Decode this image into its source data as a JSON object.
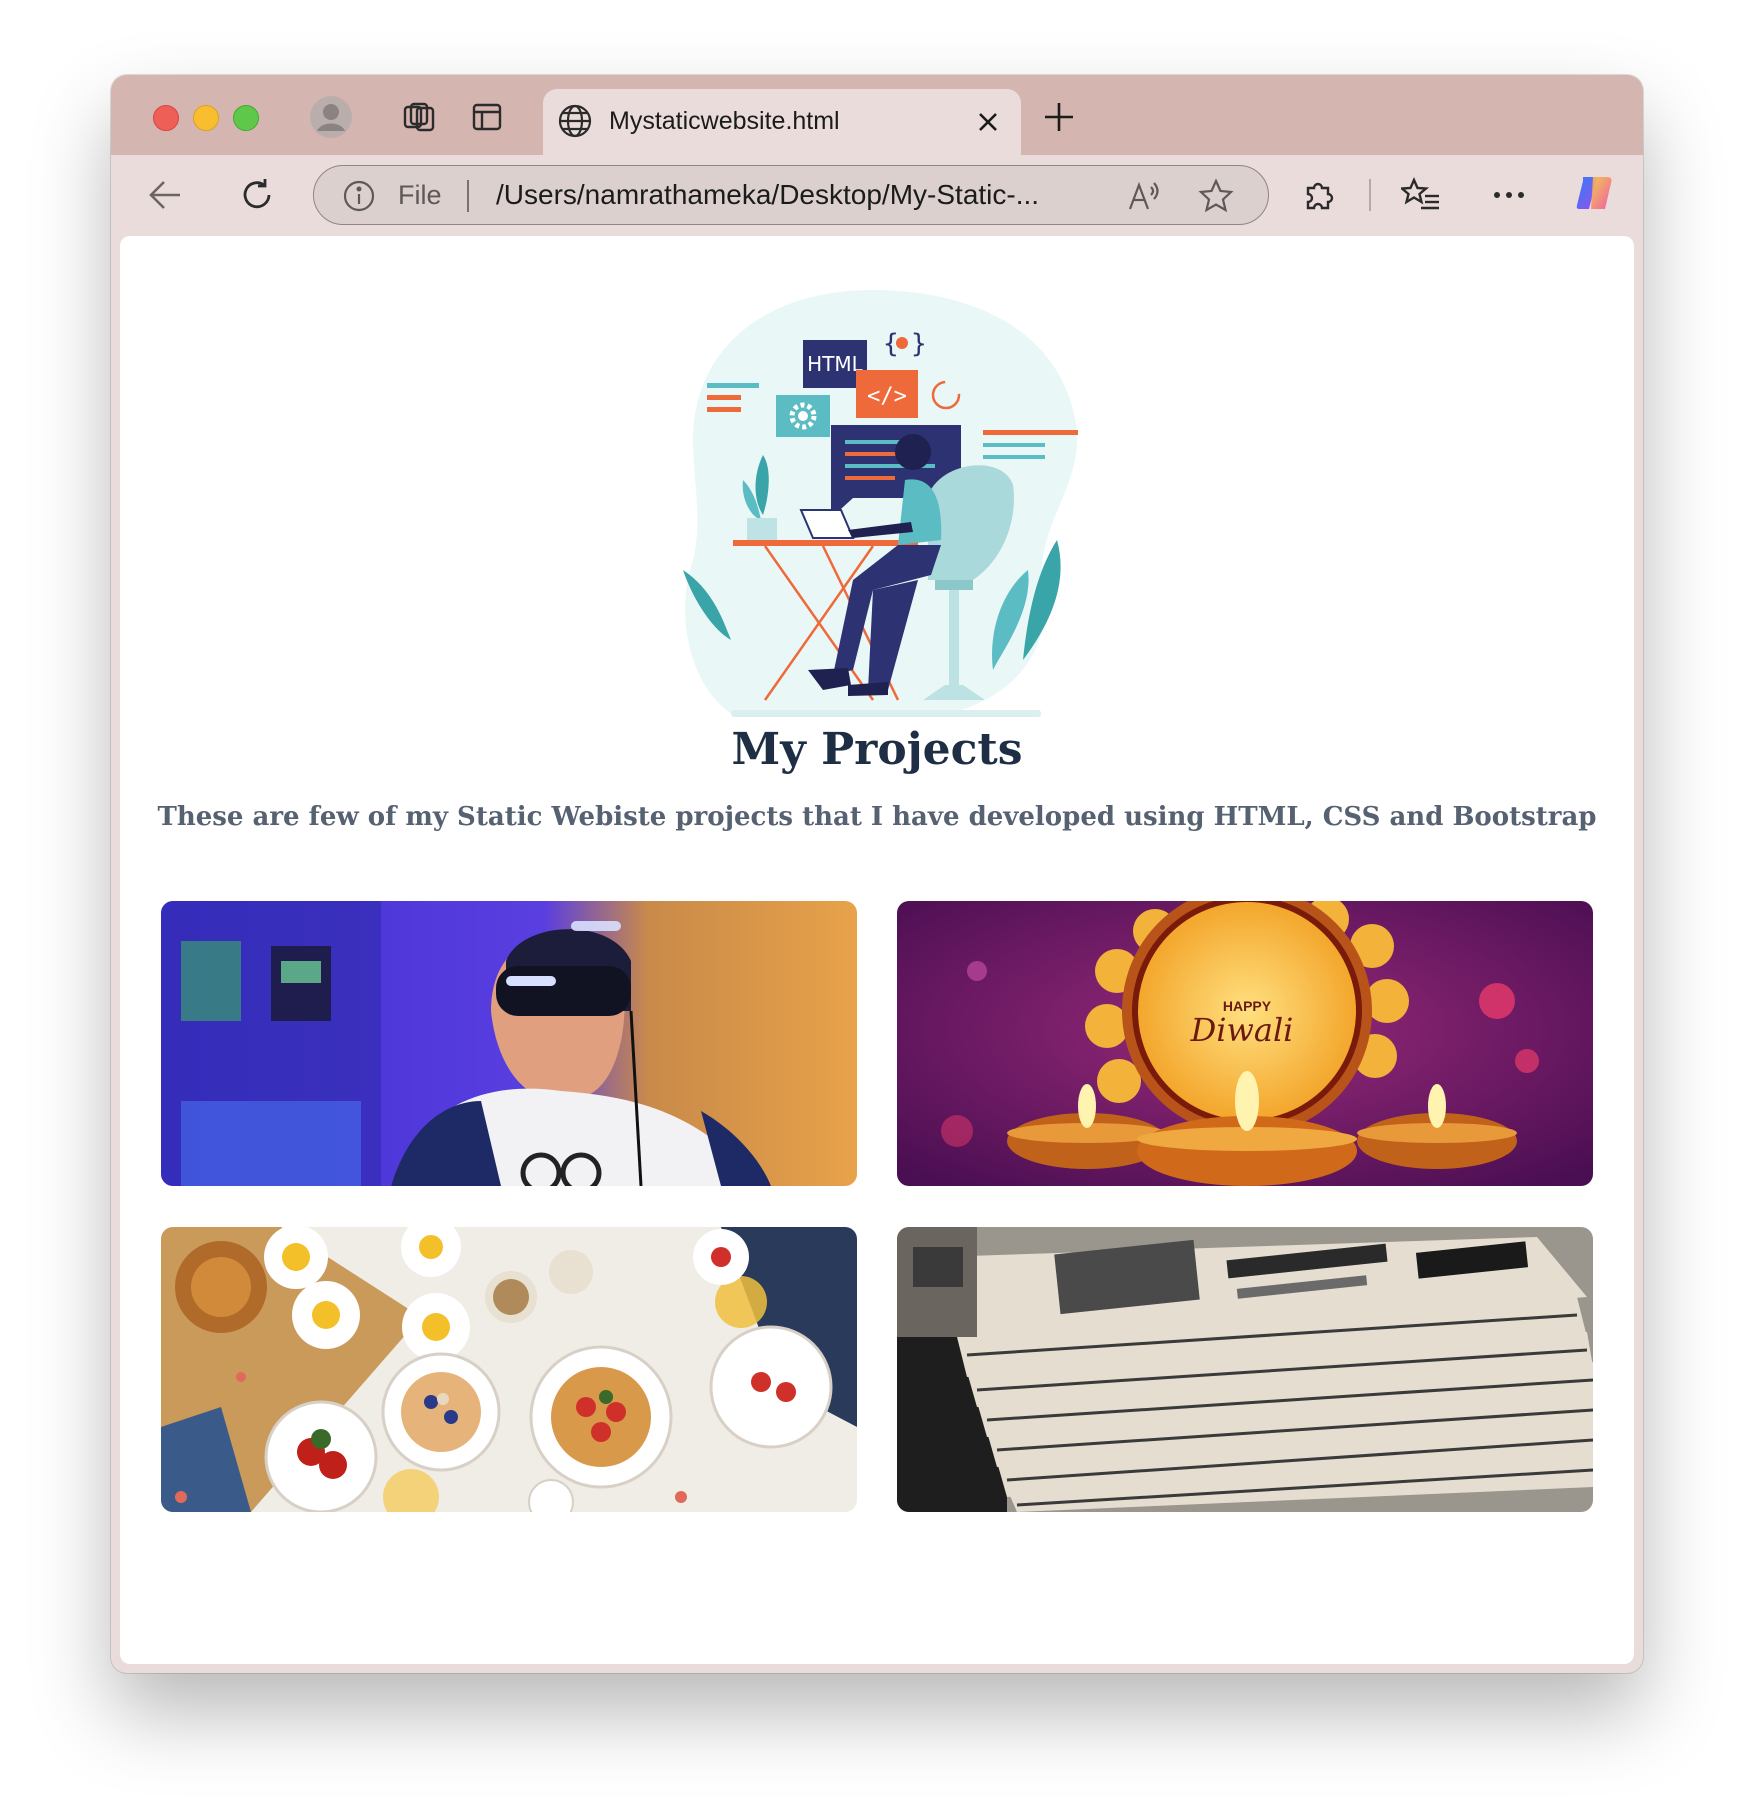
{
  "browser": {
    "tab": {
      "title": "Mystaticwebsite.html",
      "icon": "globe-icon"
    },
    "urlbar": {
      "scheme_label": "File",
      "url": "/Users/namrathameka/Desktop/My-Static-..."
    }
  },
  "page": {
    "title": "My Projects",
    "subtitle": "These are few of my Static Webiste projects that I have developed using HTML, CSS and Bootstrap",
    "hero_badge": "HTML",
    "projects": [
      {
        "image": "vr-headset-photo"
      },
      {
        "image": "happy-diwali-photo",
        "caption_line1": "HAPPY",
        "caption_line2": "Diwali"
      },
      {
        "image": "breakfast-table-photo"
      },
      {
        "image": "newspaper-stack-photo"
      }
    ]
  }
}
